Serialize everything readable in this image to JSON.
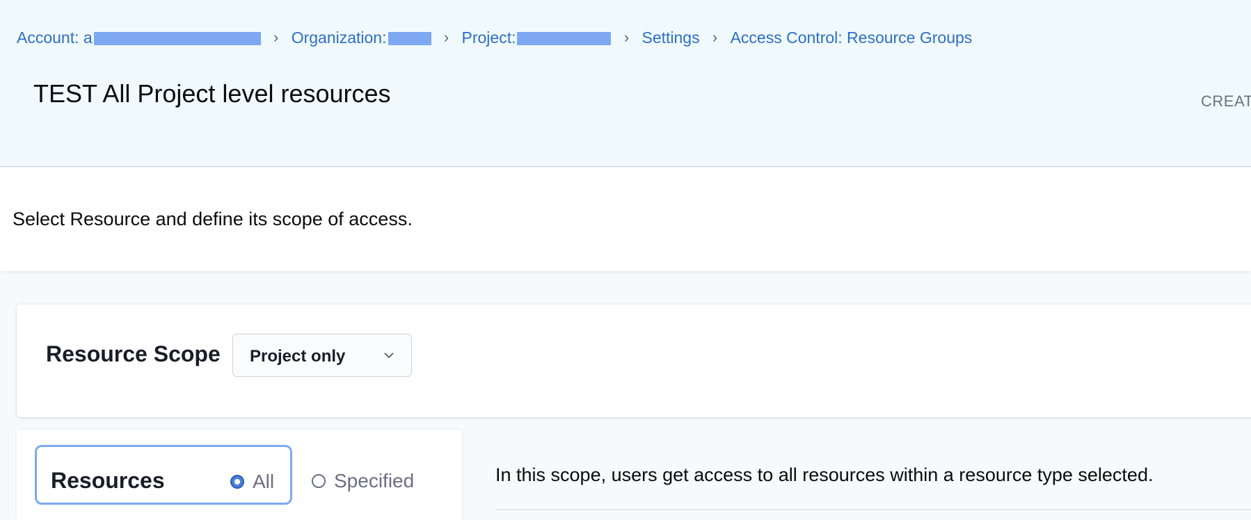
{
  "breadcrumb": {
    "account_label": "Account: a",
    "organization_label": "Organization: ",
    "project_label": "Project: ",
    "settings_label": "Settings",
    "access_control_label": "Access Control: Resource Groups",
    "separator": "›"
  },
  "header": {
    "title": "TEST All Project level resources",
    "created_label": "CREAT"
  },
  "intro": {
    "text": "Select Resource and define its scope of access."
  },
  "scope": {
    "label": "Resource Scope",
    "selected": "Project only"
  },
  "resources": {
    "label": "Resources",
    "options": [
      {
        "label": "All",
        "checked": true
      },
      {
        "label": "Specified",
        "checked": false
      }
    ],
    "description": "In this scope, users get access to all resources within a resource type selected."
  },
  "colors": {
    "link": "#2d6fc4",
    "header_bg": "#f0f9fc",
    "accent": "#7ea8f2",
    "radio_on": "#4b80d8"
  }
}
